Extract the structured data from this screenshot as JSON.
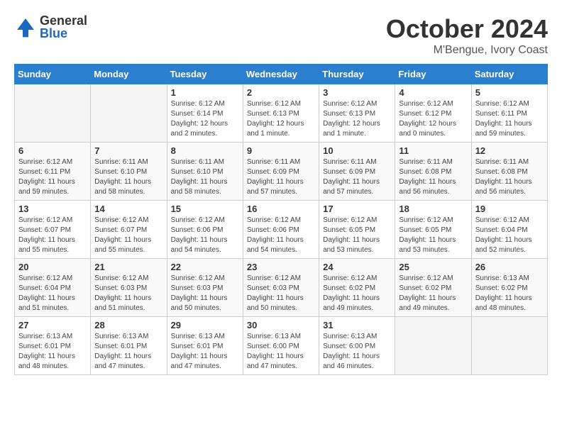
{
  "header": {
    "logo_general": "General",
    "logo_blue": "Blue",
    "month_title": "October 2024",
    "location": "M'Bengue, Ivory Coast"
  },
  "weekdays": [
    "Sunday",
    "Monday",
    "Tuesday",
    "Wednesday",
    "Thursday",
    "Friday",
    "Saturday"
  ],
  "weeks": [
    [
      {
        "day": "",
        "empty": true
      },
      {
        "day": "",
        "empty": true
      },
      {
        "day": "1",
        "sunrise": "6:12 AM",
        "sunset": "6:14 PM",
        "daylight": "12 hours and 2 minutes."
      },
      {
        "day": "2",
        "sunrise": "6:12 AM",
        "sunset": "6:13 PM",
        "daylight": "12 hours and 1 minute."
      },
      {
        "day": "3",
        "sunrise": "6:12 AM",
        "sunset": "6:13 PM",
        "daylight": "12 hours and 1 minute."
      },
      {
        "day": "4",
        "sunrise": "6:12 AM",
        "sunset": "6:12 PM",
        "daylight": "12 hours and 0 minutes."
      },
      {
        "day": "5",
        "sunrise": "6:12 AM",
        "sunset": "6:11 PM",
        "daylight": "11 hours and 59 minutes."
      }
    ],
    [
      {
        "day": "6",
        "sunrise": "6:12 AM",
        "sunset": "6:11 PM",
        "daylight": "11 hours and 59 minutes."
      },
      {
        "day": "7",
        "sunrise": "6:11 AM",
        "sunset": "6:10 PM",
        "daylight": "11 hours and 58 minutes."
      },
      {
        "day": "8",
        "sunrise": "6:11 AM",
        "sunset": "6:10 PM",
        "daylight": "11 hours and 58 minutes."
      },
      {
        "day": "9",
        "sunrise": "6:11 AM",
        "sunset": "6:09 PM",
        "daylight": "11 hours and 57 minutes."
      },
      {
        "day": "10",
        "sunrise": "6:11 AM",
        "sunset": "6:09 PM",
        "daylight": "11 hours and 57 minutes."
      },
      {
        "day": "11",
        "sunrise": "6:11 AM",
        "sunset": "6:08 PM",
        "daylight": "11 hours and 56 minutes."
      },
      {
        "day": "12",
        "sunrise": "6:11 AM",
        "sunset": "6:08 PM",
        "daylight": "11 hours and 56 minutes."
      }
    ],
    [
      {
        "day": "13",
        "sunrise": "6:12 AM",
        "sunset": "6:07 PM",
        "daylight": "11 hours and 55 minutes."
      },
      {
        "day": "14",
        "sunrise": "6:12 AM",
        "sunset": "6:07 PM",
        "daylight": "11 hours and 55 minutes."
      },
      {
        "day": "15",
        "sunrise": "6:12 AM",
        "sunset": "6:06 PM",
        "daylight": "11 hours and 54 minutes."
      },
      {
        "day": "16",
        "sunrise": "6:12 AM",
        "sunset": "6:06 PM",
        "daylight": "11 hours and 54 minutes."
      },
      {
        "day": "17",
        "sunrise": "6:12 AM",
        "sunset": "6:05 PM",
        "daylight": "11 hours and 53 minutes."
      },
      {
        "day": "18",
        "sunrise": "6:12 AM",
        "sunset": "6:05 PM",
        "daylight": "11 hours and 53 minutes."
      },
      {
        "day": "19",
        "sunrise": "6:12 AM",
        "sunset": "6:04 PM",
        "daylight": "11 hours and 52 minutes."
      }
    ],
    [
      {
        "day": "20",
        "sunrise": "6:12 AM",
        "sunset": "6:04 PM",
        "daylight": "11 hours and 51 minutes."
      },
      {
        "day": "21",
        "sunrise": "6:12 AM",
        "sunset": "6:03 PM",
        "daylight": "11 hours and 51 minutes."
      },
      {
        "day": "22",
        "sunrise": "6:12 AM",
        "sunset": "6:03 PM",
        "daylight": "11 hours and 50 minutes."
      },
      {
        "day": "23",
        "sunrise": "6:12 AM",
        "sunset": "6:03 PM",
        "daylight": "11 hours and 50 minutes."
      },
      {
        "day": "24",
        "sunrise": "6:12 AM",
        "sunset": "6:02 PM",
        "daylight": "11 hours and 49 minutes."
      },
      {
        "day": "25",
        "sunrise": "6:12 AM",
        "sunset": "6:02 PM",
        "daylight": "11 hours and 49 minutes."
      },
      {
        "day": "26",
        "sunrise": "6:13 AM",
        "sunset": "6:02 PM",
        "daylight": "11 hours and 48 minutes."
      }
    ],
    [
      {
        "day": "27",
        "sunrise": "6:13 AM",
        "sunset": "6:01 PM",
        "daylight": "11 hours and 48 minutes."
      },
      {
        "day": "28",
        "sunrise": "6:13 AM",
        "sunset": "6:01 PM",
        "daylight": "11 hours and 47 minutes."
      },
      {
        "day": "29",
        "sunrise": "6:13 AM",
        "sunset": "6:01 PM",
        "daylight": "11 hours and 47 minutes."
      },
      {
        "day": "30",
        "sunrise": "6:13 AM",
        "sunset": "6:00 PM",
        "daylight": "11 hours and 47 minutes."
      },
      {
        "day": "31",
        "sunrise": "6:13 AM",
        "sunset": "6:00 PM",
        "daylight": "11 hours and 46 minutes."
      },
      {
        "day": "",
        "empty": true
      },
      {
        "day": "",
        "empty": true
      }
    ]
  ]
}
